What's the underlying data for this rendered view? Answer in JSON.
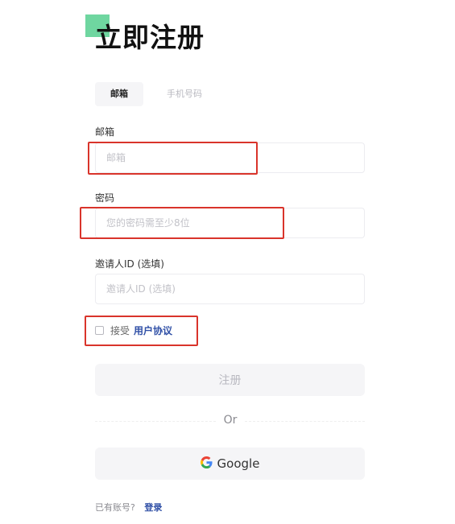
{
  "header": {
    "title": "立即注册",
    "accent_color": "#6fd6a0"
  },
  "tabs": [
    {
      "label": "邮箱",
      "selected": true
    },
    {
      "label": "手机号码",
      "selected": false
    }
  ],
  "form": {
    "email": {
      "label": "邮箱",
      "placeholder": "邮箱",
      "value": ""
    },
    "password": {
      "label": "密码",
      "placeholder": "您的密码需至少8位",
      "value": ""
    },
    "referrer": {
      "label": "邀请人ID (选填)",
      "placeholder": "邀请人ID (选填)",
      "value": ""
    }
  },
  "agreement": {
    "checked": false,
    "prefix": "接受",
    "link": "用户协议"
  },
  "register_button": "注册",
  "divider_text": "Or",
  "google_button": "Google",
  "footer": {
    "text": "已有账号?",
    "login_link": "登录"
  },
  "colors": {
    "highlight_box": "#d9342b",
    "link": "#2f4fa6"
  }
}
